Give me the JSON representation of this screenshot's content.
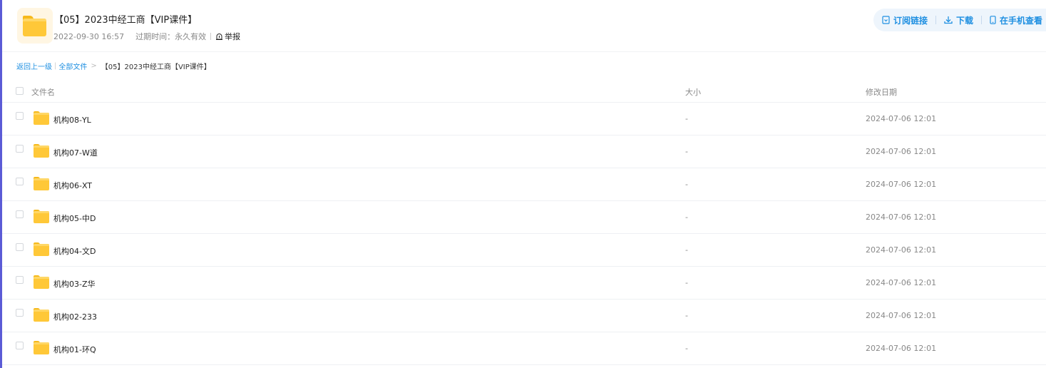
{
  "share": {
    "title": "【05】2023中经工商【VIP课件】",
    "date": "2022-09-30 16:57",
    "expire": "过期时间：永久有效",
    "report": "举报"
  },
  "actions": {
    "subscribe": "订阅链接",
    "download": "下载",
    "mobile": "在手机查看"
  },
  "breadcrumb": {
    "back": "返回上一级",
    "all": "全部文件",
    "arrow": ">",
    "current": "【05】2023中经工商【VIP课件】"
  },
  "columns": {
    "name": "文件名",
    "size": "大小",
    "date": "修改日期"
  },
  "files": [
    {
      "name": "机构08-YL",
      "size": "-",
      "date": "2024-07-06 12:01"
    },
    {
      "name": "机构07-W道",
      "size": "-",
      "date": "2024-07-06 12:01"
    },
    {
      "name": "机构06-XT",
      "size": "-",
      "date": "2024-07-06 12:01"
    },
    {
      "name": "机构05-中D",
      "size": "-",
      "date": "2024-07-06 12:01"
    },
    {
      "name": "机构04-文D",
      "size": "-",
      "date": "2024-07-06 12:01"
    },
    {
      "name": "机构03-Z华",
      "size": "-",
      "date": "2024-07-06 12:01"
    },
    {
      "name": "机构02-233",
      "size": "-",
      "date": "2024-07-06 12:01"
    },
    {
      "name": "机构01-环Q",
      "size": "-",
      "date": "2024-07-06 12:01"
    }
  ],
  "colors": {
    "accent": "#1e8fe1",
    "folder": "#ffc838",
    "left_edge": "#5b5bd6"
  }
}
